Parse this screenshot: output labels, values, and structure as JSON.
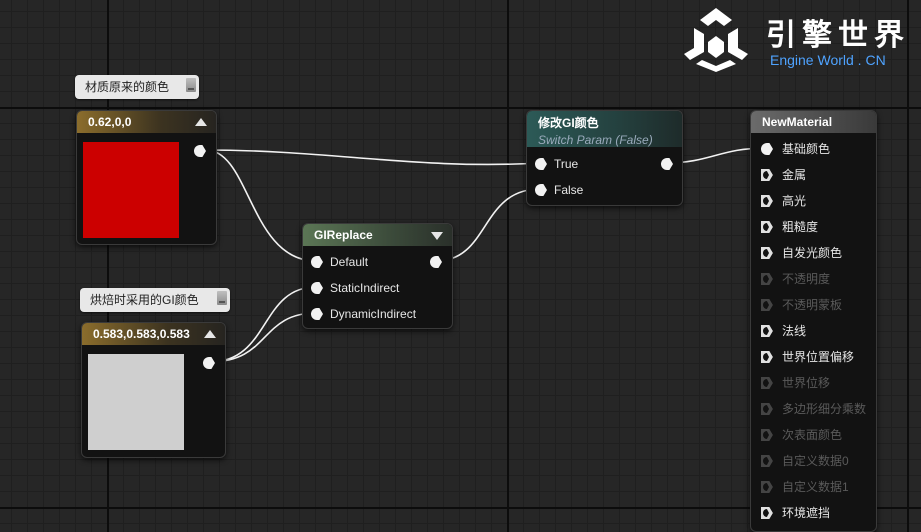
{
  "comments": {
    "orig_color": "材质原来的颜色",
    "bake_color": "烘焙时采用的GI颜色"
  },
  "nodes": {
    "const_red": {
      "title": "0.62,0,0",
      "color": "#cc0000"
    },
    "const_grey": {
      "title": "0.583,0.583,0.583",
      "color": "#cfcfcf"
    },
    "gireplace": {
      "title": "GIReplace",
      "pins": [
        "Default",
        "StaticIndirect",
        "DynamicIndirect"
      ]
    },
    "switch": {
      "title": "修改GI颜色",
      "subtitle": "Switch Param (False)",
      "pins": [
        "True",
        "False"
      ]
    },
    "material": {
      "title": "NewMaterial",
      "pins": [
        {
          "label": "基础颜色",
          "enabled": true,
          "connected": true
        },
        {
          "label": "金属",
          "enabled": true,
          "connected": false
        },
        {
          "label": "高光",
          "enabled": true,
          "connected": false
        },
        {
          "label": "粗糙度",
          "enabled": true,
          "connected": false
        },
        {
          "label": "自发光颜色",
          "enabled": true,
          "connected": false
        },
        {
          "label": "不透明度",
          "enabled": false,
          "connected": false
        },
        {
          "label": "不透明蒙板",
          "enabled": false,
          "connected": false
        },
        {
          "label": "法线",
          "enabled": true,
          "connected": false
        },
        {
          "label": "世界位置偏移",
          "enabled": true,
          "connected": false
        },
        {
          "label": "世界位移",
          "enabled": false,
          "connected": false
        },
        {
          "label": "多边形细分乘数",
          "enabled": false,
          "connected": false
        },
        {
          "label": "次表面颜色",
          "enabled": false,
          "connected": false
        },
        {
          "label": "自定义数据0",
          "enabled": false,
          "connected": false
        },
        {
          "label": "自定义数据1",
          "enabled": false,
          "connected": false
        },
        {
          "label": "环境遮挡",
          "enabled": true,
          "connected": false
        }
      ]
    }
  },
  "watermark": {
    "title": "引擎世界",
    "subtitle": "Engine World . CN"
  }
}
